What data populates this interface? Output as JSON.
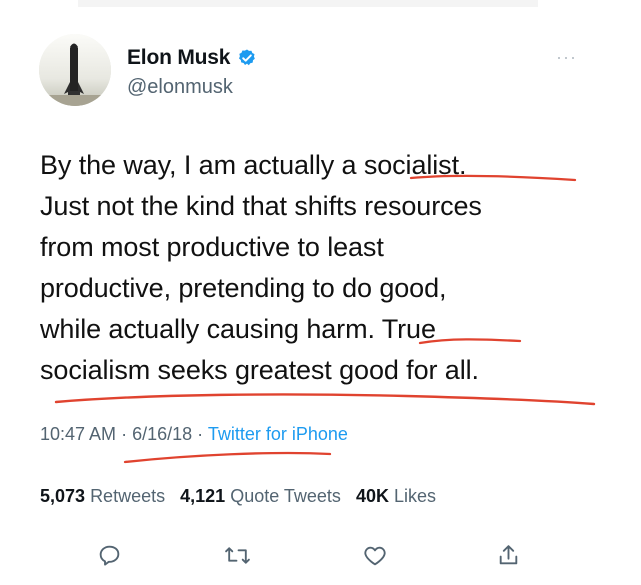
{
  "tweet": {
    "display_name": "Elon Musk",
    "handle": "@elonmusk",
    "more_label": "···",
    "text_lines": [
      "By the way, I am actually a socialist.",
      "Just not the kind that shifts resources",
      "from most productive to least",
      "productive, pretending to do good,",
      "while actually causing harm. True",
      "socialism seeks greatest good for all."
    ],
    "time": "10:47 AM",
    "separator": "·",
    "date": "6/16/18",
    "app": "Twitter for iPhone",
    "stats": {
      "retweets_count": "5,073",
      "retweets_label": "Retweets",
      "quote_tweets_count": "4,121",
      "quote_tweets_label": "Quote Tweets",
      "likes_count": "40K",
      "likes_label": "Likes"
    }
  },
  "icons": {
    "verified": "verified-badge-icon",
    "reply": "reply-icon",
    "retweet": "retweet-icon",
    "like": "heart-icon",
    "share": "share-icon"
  },
  "colors": {
    "text": "#0f1419",
    "secondary_text": "#536471",
    "link": "#1d9bf0",
    "verified": "#1d9bf0",
    "annotation": "#e0432f"
  }
}
